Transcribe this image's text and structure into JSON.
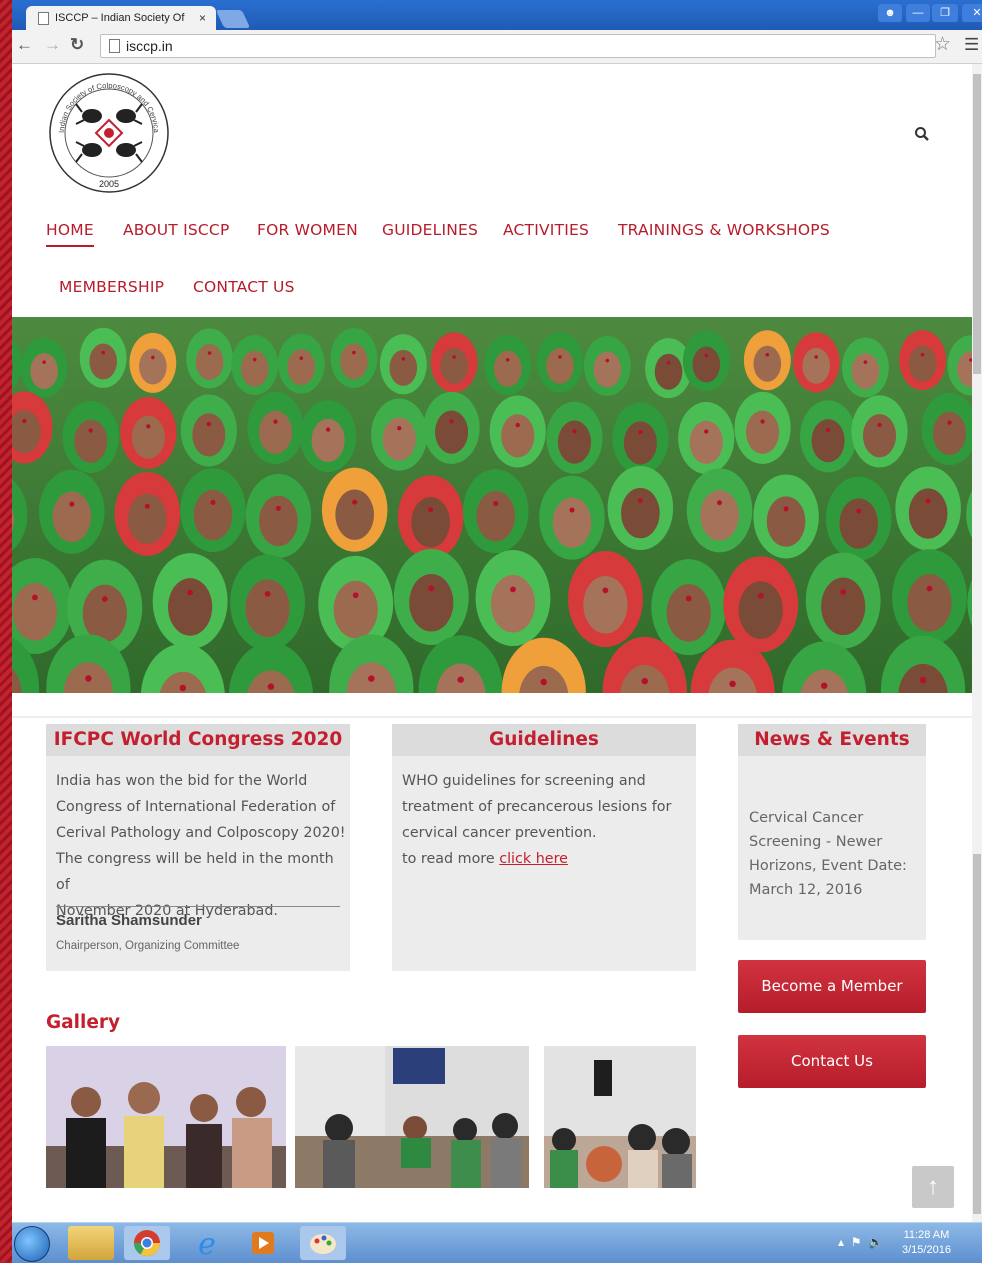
{
  "browser": {
    "tab_title": "ISCCP – Indian Society Of",
    "tab_close": "×",
    "url": "isccp.in"
  },
  "site": {
    "logo_text": "Indian Society of Colposcopy and Cervical Pathology (ISCCP)",
    "logo_year": "2005",
    "nav": [
      {
        "label": "HOME",
        "active": true
      },
      {
        "label": "ABOUT ISCCP"
      },
      {
        "label": "FOR WOMEN"
      },
      {
        "label": "GUIDELINES"
      },
      {
        "label": "ACTIVITIES"
      },
      {
        "label": "TRAININGS & WORKSHOPS"
      },
      {
        "label": "MEMBERSHIP"
      },
      {
        "label": "CONTACT US"
      }
    ]
  },
  "panels": {
    "congress": {
      "title": "IFCPC World Congress 2020",
      "lines": [
        "India has won the bid for the World",
        "Congress of International Federation of",
        "Cerival Pathology and Colposcopy 2020!",
        "The congress will be held in the month of",
        "November 2020 at Hyderabad."
      ],
      "signatory": "Saritha Shamsunder",
      "role": "Chairperson, Organizing Committee"
    },
    "guidelines": {
      "title": "Guidelines",
      "lines": [
        "WHO guidelines for screening and",
        "treatment of precancerous lesions for",
        "cervical cancer prevention."
      ],
      "read_more_prefix": "to read more ",
      "read_more_link": "click here"
    },
    "news": {
      "title": "News & Events",
      "lines": [
        "Cervical Cancer",
        "Screening - Newer",
        "Horizons, Event Date:",
        "March 12, 2016"
      ]
    }
  },
  "buttons": {
    "become_member": "Become a Member",
    "contact_us": "Contact Us"
  },
  "gallery": {
    "title": "Gallery"
  },
  "taskbar": {
    "time": "11:28 AM",
    "date": "3/15/2016"
  }
}
